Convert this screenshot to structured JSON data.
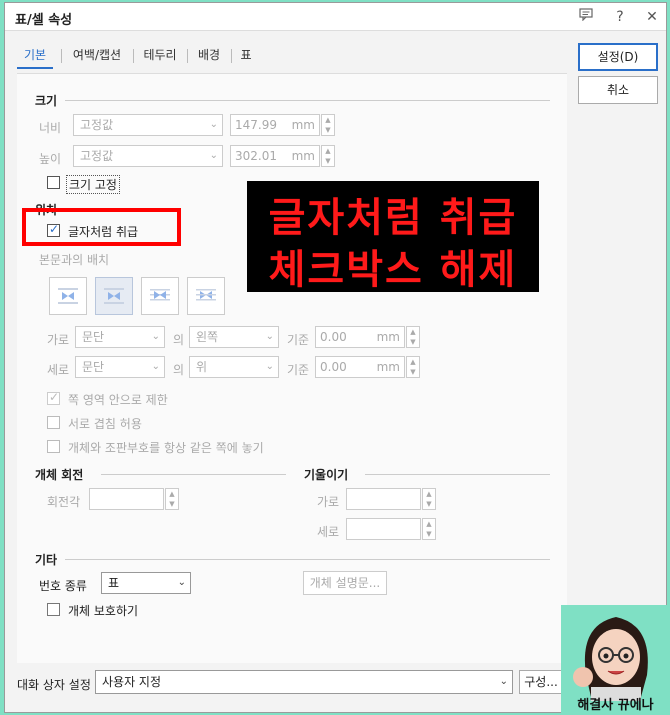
{
  "window": {
    "title": "표/셀 속성",
    "help_icon": "?",
    "chat_icon": "chat-icon",
    "close_icon": "✕"
  },
  "tabs": [
    {
      "label": "기본",
      "active": true
    },
    {
      "label": "여백/캡션",
      "active": false
    },
    {
      "label": "테두리",
      "active": false
    },
    {
      "label": "배경",
      "active": false
    },
    {
      "label": "표",
      "active": false
    }
  ],
  "size": {
    "section_title": "크기",
    "width_label": "너비",
    "width_mode": "고정값",
    "width_value": "147.99",
    "width_unit": "mm",
    "height_label": "높이",
    "height_mode": "고정값",
    "height_value": "302.01",
    "height_unit": "mm",
    "fix_size_label": "크기 고정",
    "fix_size_checked": false
  },
  "position": {
    "section_title": "위치",
    "treat_as_char_label": "글자처럼 취급",
    "treat_as_char_checked": true,
    "wrap_label": "본문과의 배치",
    "horizontal_label": "가로",
    "horizontal_mode": "문단",
    "horizontal_of": "의",
    "horizontal_ref": "왼쪽",
    "horizontal_base_label": "기준",
    "horizontal_value": "0.00",
    "horizontal_unit": "mm",
    "vertical_label": "세로",
    "vertical_mode": "문단",
    "vertical_of": "의",
    "vertical_ref": "위",
    "vertical_base_label": "기준",
    "vertical_value": "0.00",
    "vertical_unit": "mm",
    "limit_in_page_label": "쪽 영역 안으로 제한",
    "limit_in_page_checked": true,
    "allow_overlap_label": "서로 겹침 허용",
    "allow_overlap_checked": false,
    "same_page_label": "개체와 조판부호를 항상 같은 쪽에 놓기",
    "same_page_checked": false
  },
  "rotation": {
    "section_title": "개체 회전",
    "angle_label": "회전각",
    "angle_value": ""
  },
  "skew": {
    "section_title": "기울이기",
    "horizontal_label": "가로",
    "horizontal_value": "",
    "vertical_label": "세로",
    "vertical_value": ""
  },
  "etc": {
    "section_title": "기타",
    "number_type_label": "번호 종류",
    "number_type_value": "표",
    "description_button": "개체 설명문...",
    "protect_label": "개체 보호하기",
    "protect_checked": false
  },
  "footer": {
    "dialog_setting_label": "대화 상자 설정",
    "dialog_setting_value": "사용자 지정",
    "configure_button": "구성..."
  },
  "buttons": {
    "ok": "설정(D)",
    "cancel": "취소"
  },
  "annotation": {
    "line1": "글자처럼 취급",
    "line2": "체크박스 해제"
  },
  "watermark": {
    "text": "해결사 뀨에나"
  },
  "colors": {
    "accent": "#2a6fc9",
    "annotation_red": "#ff1a1a",
    "highlight_box": "#ff0000",
    "background": "#7fe0c4"
  }
}
